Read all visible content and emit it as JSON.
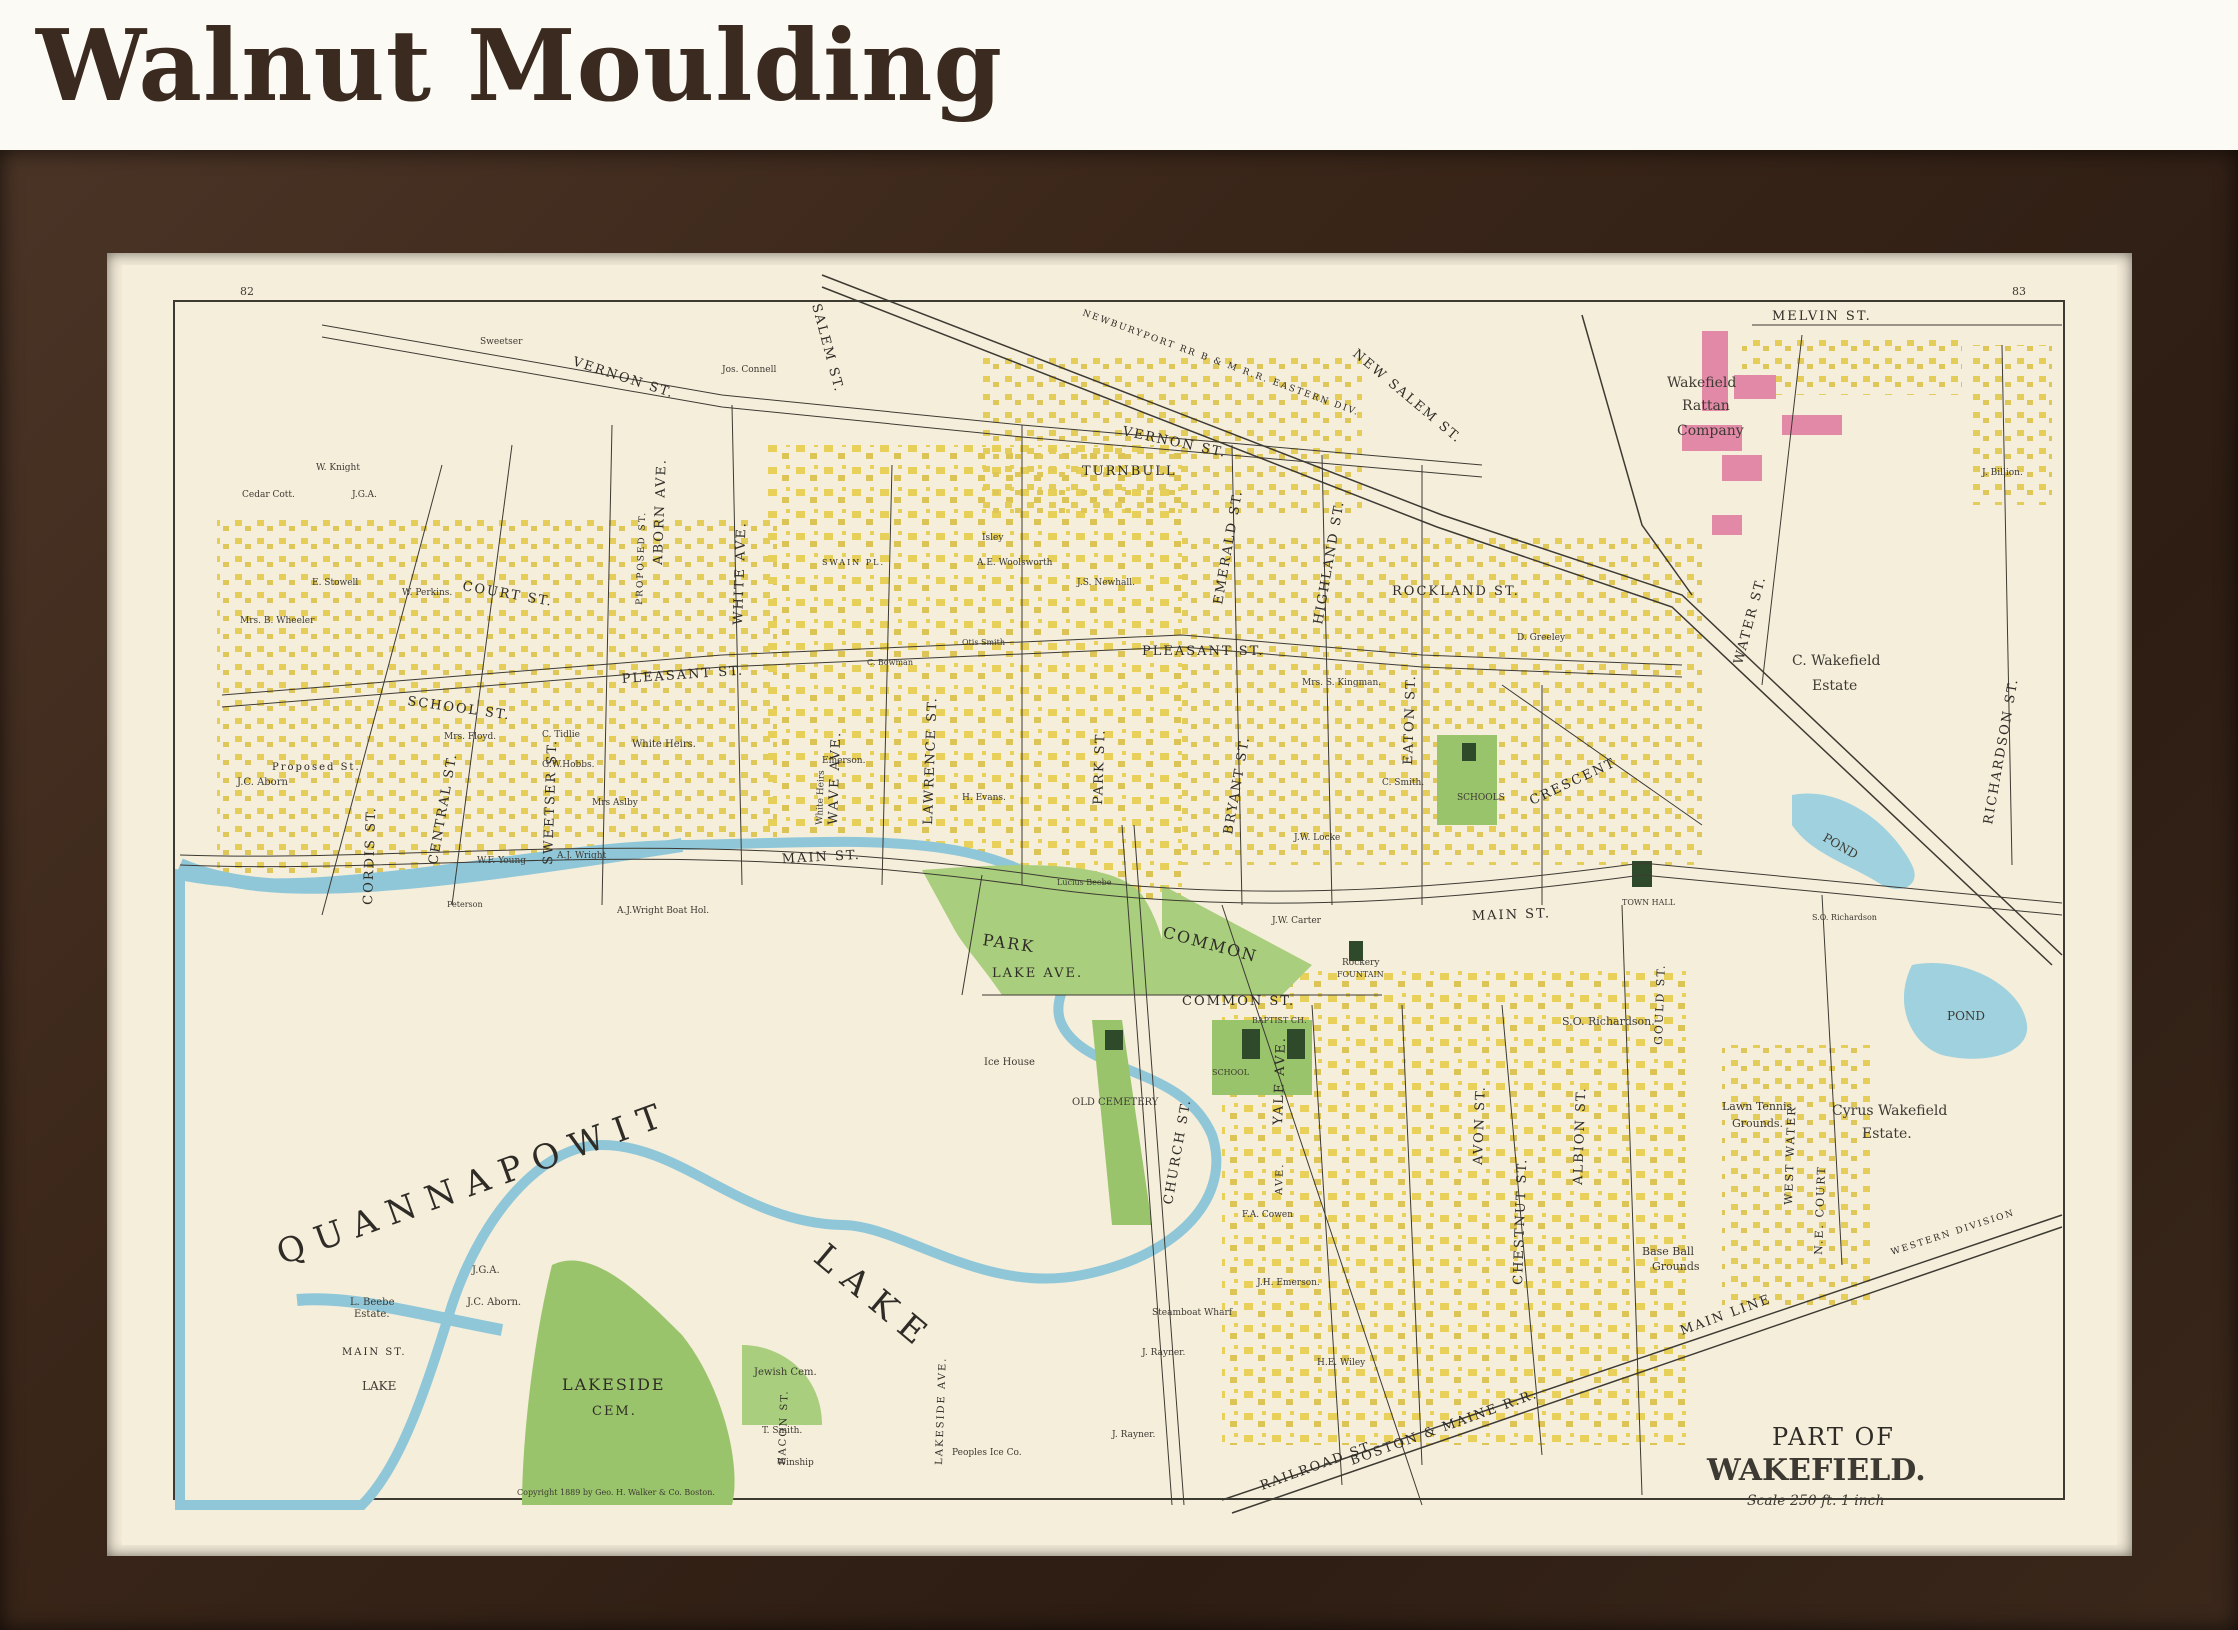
{
  "header": {
    "title": "Walnut Moulding"
  },
  "map": {
    "title_part": "PART OF",
    "title_town": "WAKEFIELD.",
    "scale": "Scale 250 ft. 1 inch",
    "page_left": "82",
    "page_right": "83",
    "copyright": "Copyright 1889 by Geo. H. Walker & Co. Boston.",
    "water": {
      "lake_word1": "QUANNAPOWIT",
      "lake_word2": "LAKE",
      "pond_upper": "POND",
      "pond_lower": "POND",
      "small_lake": "LAKE"
    },
    "parks": {
      "park": "PARK",
      "common": "COMMON",
      "cemetery": "LAKESIDE",
      "cemetery_2": "CEM.",
      "old_cemetery": "OLD CEMETERY",
      "jewish_cem": "Jewish Cem."
    },
    "streets": {
      "main": "MAIN ST.",
      "main_east": "MAIN ST.",
      "pleasant": "PLEASANT ST.",
      "pleasant_east": "PLEASANT ST.",
      "school": "SCHOOL ST.",
      "court": "COURT ST.",
      "vernon": "VERNON ST.",
      "vernon_east": "VERNON ST.",
      "salem": "SALEM ST.",
      "new_salem": "NEW SALEM ST.",
      "melvin": "MELVIN ST.",
      "water": "WATER ST.",
      "west_water": "WEST WATER",
      "richardson": "RICHARDSON ST.",
      "crescent": "CRESCENT",
      "church": "CHURCH ST.",
      "common_st": "COMMON ST.",
      "lake_ave": "LAKE AVE.",
      "railroad": "RAILROAD ST.",
      "boston_maine": "BOSTON & MAINE R.R.",
      "main_line": "MAIN LINE",
      "western_div": "WESTERN DIVISION",
      "eastern_div": "NEWBURYPORT RR B & M R.R. EASTERN DIV.",
      "cordis": "CORDIS ST.",
      "central": "CENTRAL ST.",
      "sweetser": "SWEETSER ST.",
      "abborn": "ABORN AVE.",
      "white": "WHITE AVE.",
      "lawrence": "LAWRENCE ST.",
      "wave": "WAVE AVE.",
      "park_st": "PARK ST.",
      "bryant": "BRYANT ST.",
      "emerald": "EMERALD ST.",
      "highland": "HIGHLAND ST.",
      "rockland": "ROCKLAND ST.",
      "turnbull": "TURNBULL",
      "eaton": "EATON ST.",
      "swain": "SWAIN PL.",
      "lakeside_ave": "LAKESIDE AVE.",
      "bacon": "BACON ST.",
      "albion": "ALBION ST.",
      "chestnut": "CHESTNUT ST.",
      "avon": "AVON ST.",
      "yale": "YALE AVE.",
      "ne_court": "N.E. COURT",
      "gould": "GOULD ST.",
      "proposed_st": "Proposed St.",
      "proposed": "PROPOSED ST.",
      "lake_main": "MAIN ST.",
      "ave_label": "AVE."
    },
    "places": {
      "wakefield_rattan": "Wakefield",
      "rattan": "Rattan",
      "company": "Company",
      "c_wakefield": "C. Wakefield",
      "estate": "Estate",
      "cyrus_wakefield": "Cyrus Wakefield",
      "estate2": "Estate.",
      "lawn_tennis": "Lawn Tennis",
      "grounds": "Grounds.",
      "base_ball": "Base Ball",
      "grounds2": "Grounds",
      "schools": "SCHOOLS",
      "town_hall": "TOWN HALL",
      "rockery": "Rockery",
      "fountain": "FOUNTAIN",
      "ice_house": "Ice House",
      "steamboat_wharf": "Steamboat Wharf",
      "peoples_ice": "Peoples Ice Co.",
      "l_beebe": "L. Beebe",
      "l_beebe_estate": "Estate.",
      "boat_house": "A.J.Wright Boat Hol.",
      "lucius_beebe": "Lucius Beebe",
      "baptist": "BAPTIST CH.",
      "school_label": "SCHOOL",
      "so_richardson": "S.O. Richardson.",
      "white_heirs": "White Heirs.",
      "white_heirs2": "White Heirs",
      "j_rayner": "J. Rayner.",
      "j_rayner2": "J. Rayner.",
      "jos_connell": "Jos. Connell",
      "emerson": "Emerson.",
      "sweetser_o": "Sweetser",
      "cedar_cott": "Cedar Cott.",
      "w_knight": "W. Knight",
      "jga": "J.G.A.",
      "jc_aborn": "J.C. Aborn",
      "jga2": "J.G.A.",
      "jc_aborn2": "J.C. Aborn.",
      "e_stowell": "E. Stowell",
      "mrs_b_wheeler": "Mrs. B. Wheeler",
      "w_perkins": "W. Perkins.",
      "mrs_floyd": "Mrs. Floyd.",
      "c_tidlie": "C. Tidlie",
      "g_w_hobbs": "G.W.Hobbs.",
      "mrs_aslby": "Mrs Aslby",
      "a_j_wright": "A.J. Wright",
      "w_f_young": "W.F. Young",
      "peterson": "Peterson",
      "isley": "Isley",
      "a_e_woolsworth": "A.E. Woolsworth",
      "j_s_newhall": "J.S. Newhall.",
      "otis_smith": "Otis Smith",
      "c_bowman": "C. Bowman",
      "h_evans": "H. Evans.",
      "j_w_carter": "J.W. Carter",
      "mrs_s_kingman": "Mrs. S. Kingman.",
      "j_w_locke": "J.W. Locke",
      "c_smith": "C. Smith.",
      "d_greeley": "D. Greeley",
      "j_billion": "J. Billion.",
      "winship": "Winship",
      "t_smith": "T. Smith.",
      "h_e_wiley": "H.E. Wiley",
      "f_a_cowen": "F.A. Cowen",
      "j_h_emerson": "J.H. Emerson.",
      "s_o_richardson": "S.O. Richardson"
    }
  }
}
